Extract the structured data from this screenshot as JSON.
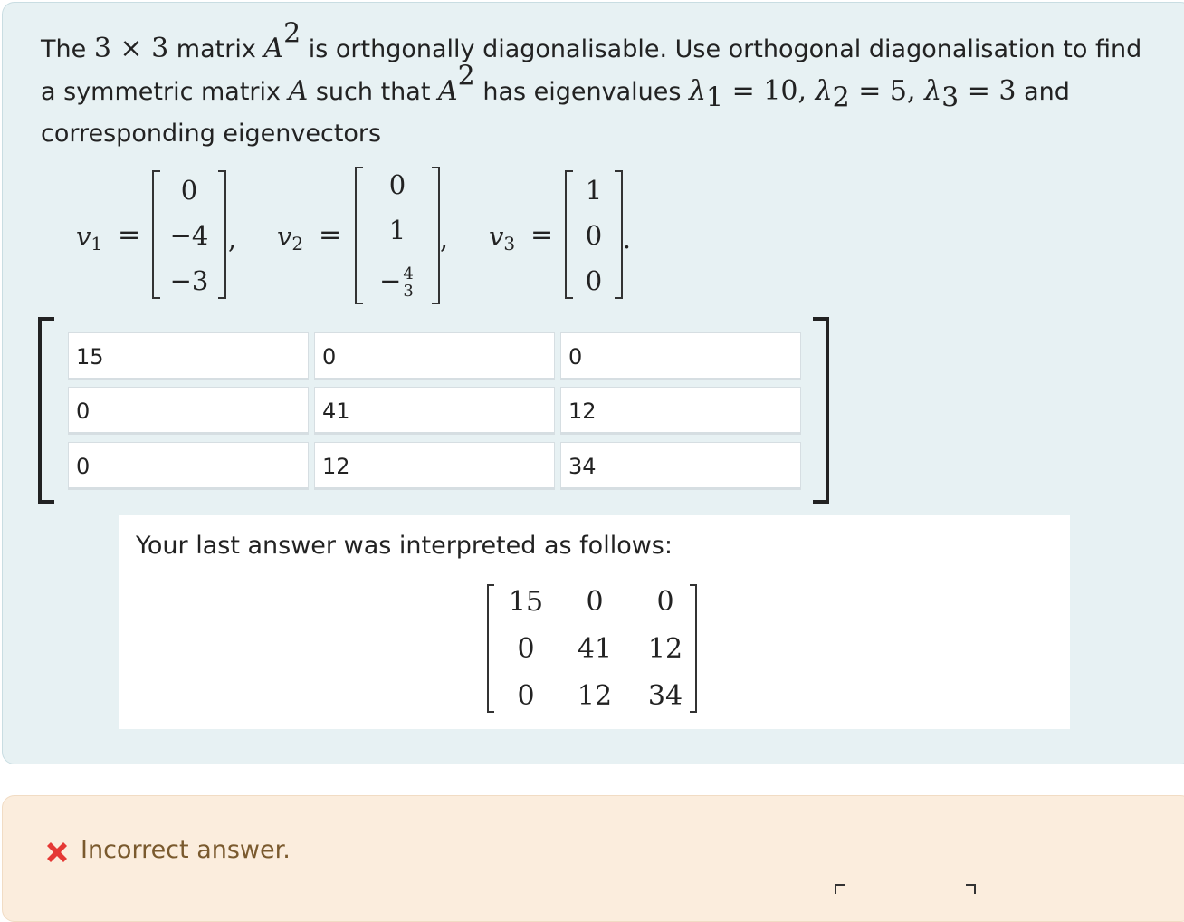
{
  "question": {
    "prompt": {
      "t1": "The ",
      "dim": "3 × 3",
      "t2": " matrix ",
      "A": "A",
      "sq": "2",
      "t3": " is orthgonally diagonalisable. Use orthogonal diagonalisation to find a symmetric matrix ",
      "t4": " such that ",
      "t5": " has eigenvalues ",
      "eig": "λ",
      "s1": "1",
      "e1": " = 10, ",
      "s2": "2",
      "e2": " = 5, ",
      "s3": "3",
      "e3": " = 3",
      "t6": " and corresponding eigenvectors"
    },
    "vectors": [
      {
        "name": "v",
        "sub": "1",
        "eq": "=",
        "entries": [
          "0",
          "−4",
          "−3"
        ],
        "punct": ","
      },
      {
        "name": "v",
        "sub": "2",
        "eq": "=",
        "entries": [
          "0",
          "1"
        ],
        "frac_sign": "−",
        "frac_num": "4",
        "frac_den": "3",
        "punct": ","
      },
      {
        "name": "v",
        "sub": "3",
        "eq": "=",
        "entries": [
          "1",
          "0",
          "0"
        ],
        "punct": "."
      }
    ]
  },
  "answer_inputs": [
    [
      "15",
      "0",
      "0"
    ],
    [
      "0",
      "41",
      "12"
    ],
    [
      "0",
      "12",
      "34"
    ]
  ],
  "preview": {
    "label": "Your last answer was interpreted as follows:",
    "matrix": [
      [
        "15",
        "0",
        "0"
      ],
      [
        "0",
        "41",
        "12"
      ],
      [
        "0",
        "12",
        "34"
      ]
    ]
  },
  "feedback": {
    "icon": "cross-icon",
    "text": "Incorrect answer.",
    "color": "#e53935"
  }
}
